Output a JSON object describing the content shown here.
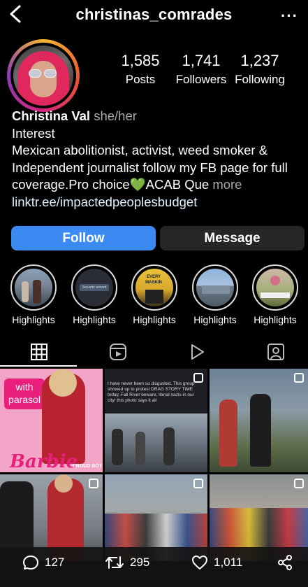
{
  "header": {
    "username": "christinas_comrades"
  },
  "profile": {
    "stats": [
      {
        "value": "1,585",
        "label": "Posts"
      },
      {
        "value": "1,741",
        "label": "Followers"
      },
      {
        "value": "1,237",
        "label": "Following"
      }
    ],
    "name": "Christina Val",
    "pronouns": "she/her",
    "category": "Interest",
    "bio": "Mexican abolitionist, activist, weed smoker & Independent journalist follow my FB page for full coverage.Pro choice💚ACAB Que",
    "bio_more": "more",
    "link": "linktr.ee/impactedpeoplesbudget"
  },
  "buttons": {
    "follow": "Follow",
    "message": "Message"
  },
  "highlights": [
    {
      "label": "Highlights"
    },
    {
      "label": "Highlights"
    },
    {
      "label": "Highlights"
    },
    {
      "label": "Highlights"
    },
    {
      "label": "Highlights"
    }
  ],
  "posts": {
    "post1_text_line1": "with",
    "post1_text_line2": "parasol",
    "post1_title": "Barbie",
    "post1_tag": "PROUD BOY",
    "post2_caption": "I have never been so disgusted. This group showed up to protest DRAG STORY TIME today. Fall River beware, literal nazis in our city! this photo says it all",
    "highlight2_text": "Security arrived",
    "highlight3_text": "EVERY MASKIN"
  },
  "actions": {
    "comments": "127",
    "reposts": "295",
    "likes": "1,011"
  },
  "colors": {
    "accent": "#3a8af2",
    "secondary_button": "#262626",
    "muted_text": "#a8a8a8"
  }
}
